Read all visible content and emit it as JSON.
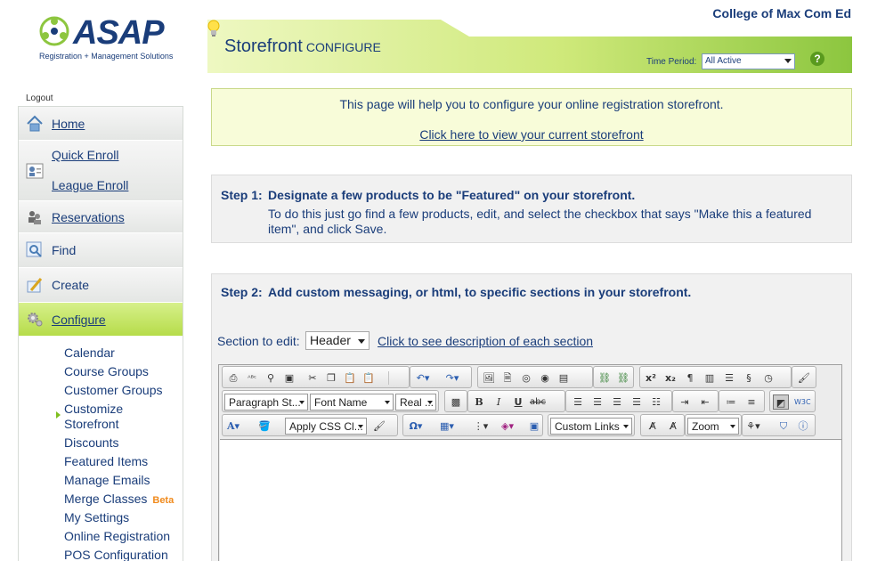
{
  "header": {
    "logo_text": "ASAP",
    "logo_tagline": "Registration + Management Solutions",
    "org_name": "College of Max Com Ed",
    "page_title": "Storefront",
    "page_subtitle": "CONFIGURE",
    "time_period_label": "Time Period:",
    "time_period_value": "All Active"
  },
  "sidebar": {
    "logout": "Logout",
    "items": [
      {
        "label": "Home"
      },
      {
        "label": "Quick Enroll"
      },
      {
        "label": "League Enroll"
      },
      {
        "label": "Reservations"
      },
      {
        "label": "Find"
      },
      {
        "label": "Create"
      },
      {
        "label": "Configure"
      }
    ],
    "configure_sub": [
      "Calendar",
      "Course Groups",
      "Customer Groups",
      "Customize",
      "Storefront",
      "Discounts",
      "Featured Items",
      "Manage Emails",
      "Merge Classes",
      "My Settings",
      "Online Registration",
      "POS Configuration"
    ],
    "beta_label": "Beta"
  },
  "info": {
    "text": "This page will help you to configure your online registration storefront.",
    "link": "Click here to view your current storefront"
  },
  "step1": {
    "num": "Step 1:",
    "title": "Designate a few products to be \"Featured\" on your storefront.",
    "desc": "To do this just go find a few products, edit, and select the checkbox that says \"Make this a featured item\", and click Save."
  },
  "step2": {
    "num": "Step 2:",
    "title": "Add custom messaging, or html, to specific sections in your storefront.",
    "section_label": "Section to edit:",
    "section_value": "Header",
    "section_link": "Click to see description of each section"
  },
  "editor": {
    "paragraph_style": "Paragraph St...",
    "font_name": "Font Name",
    "font_size": "Real ...",
    "css_class": "Apply CSS Cl...",
    "custom_links": "Custom Links",
    "zoom": "Zoom"
  }
}
